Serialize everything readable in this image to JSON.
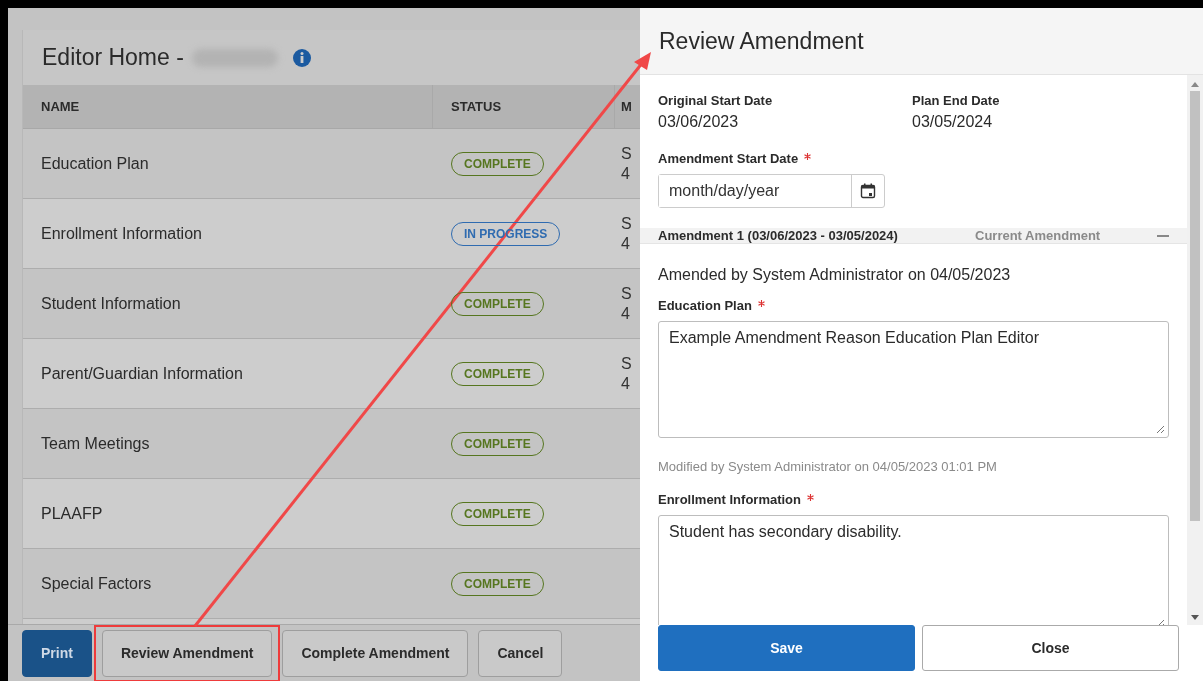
{
  "editor": {
    "title": "Editor Home -",
    "columns": [
      "NAME",
      "STATUS",
      "M"
    ],
    "rows": [
      {
        "name": "Education Plan",
        "status": {
          "label": "COMPLETE",
          "kind": "complete"
        },
        "column_3": [
          "S",
          "4"
        ]
      },
      {
        "name": "Enrollment Information",
        "status": {
          "label": "IN PROGRESS",
          "kind": "progress"
        },
        "column_3": [
          "S",
          "4"
        ]
      },
      {
        "name": "Student Information",
        "status": {
          "label": "COMPLETE",
          "kind": "complete"
        },
        "column_3": [
          "S",
          "4"
        ]
      },
      {
        "name": "Parent/Guardian Information",
        "status": {
          "label": "COMPLETE",
          "kind": "complete"
        },
        "column_3": [
          "S",
          "4"
        ]
      },
      {
        "name": "Team Meetings",
        "status": {
          "label": "COMPLETE",
          "kind": "complete"
        }
      },
      {
        "name": "PLAAFP",
        "status": {
          "label": "COMPLETE",
          "kind": "complete"
        }
      },
      {
        "name": "Special Factors",
        "status": {
          "label": "COMPLETE",
          "kind": "complete"
        }
      }
    ]
  },
  "footer_buttons": [
    {
      "label": "Print",
      "kind": "primary",
      "highlighted": false
    },
    {
      "label": "Review Amendment",
      "kind": "secondary",
      "highlighted": true
    },
    {
      "label": "Complete Amendment",
      "kind": "secondary",
      "highlighted": false
    },
    {
      "label": "Cancel",
      "kind": "secondary",
      "highlighted": false
    }
  ],
  "panel": {
    "title": "Review Amendment",
    "original_start_date": {
      "label": "Original Start Date",
      "value": "03/06/2023"
    },
    "plan_end_date": {
      "label": "Plan End Date",
      "value": "03/05/2024"
    },
    "amendment_start_date": {
      "label": "Amendment Start Date",
      "required": true,
      "placeholder": "month/day/year"
    },
    "amendment": {
      "title": "Amendment 1 (03/06/2023 - 03/05/2024)",
      "badge": "Current Amendment",
      "expanded": true,
      "amended_by": "Amended by System Administrator on 04/05/2023",
      "fields": [
        {
          "label": "Education Plan",
          "required": true,
          "value": "Example Amendment Reason Education Plan Editor",
          "note": "Modified by System Administrator on 04/05/2023 01:01 PM"
        },
        {
          "label": "Enrollment Information",
          "required": true,
          "value": "Student has secondary disability."
        }
      ]
    },
    "buttons": [
      {
        "label": "Save",
        "kind": "primary"
      },
      {
        "label": "Close",
        "kind": "secondary"
      }
    ]
  }
}
